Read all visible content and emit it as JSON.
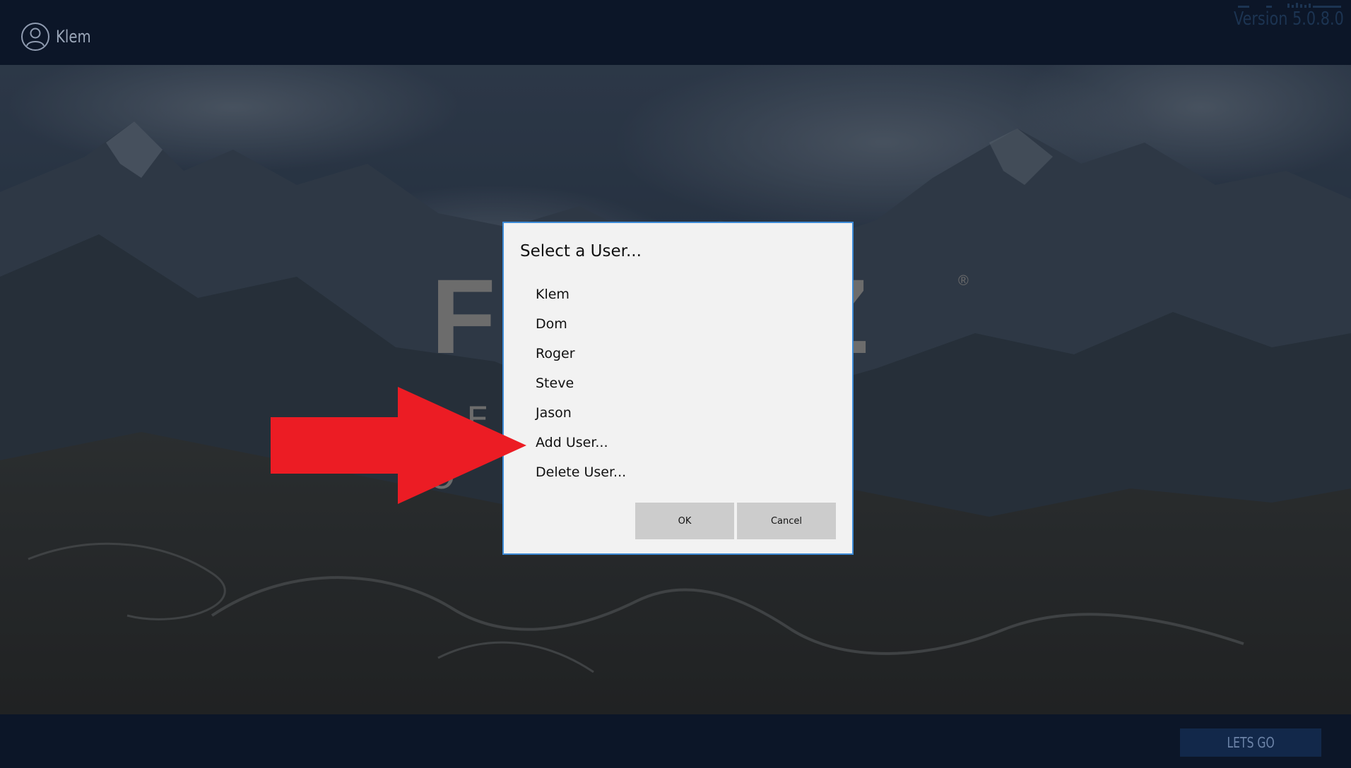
{
  "header": {
    "user_name": "Klem",
    "version": "Version 5.0.8.0"
  },
  "logo": {
    "wordmark": "F        AZ",
    "registered": "®",
    "line1": "E              A   L",
    "line2": "O             T   Y"
  },
  "dialog": {
    "title": "Select a User...",
    "items": [
      {
        "label": "Klem"
      },
      {
        "label": "Dom"
      },
      {
        "label": "Roger"
      },
      {
        "label": "Steve"
      },
      {
        "label": "Jason"
      },
      {
        "label": "Add User..."
      },
      {
        "label": "Delete User..."
      }
    ],
    "ok_label": "OK",
    "cancel_label": "Cancel"
  },
  "footer": {
    "go_label": "LETS GO"
  },
  "icons": {
    "avatar": "user-avatar-icon",
    "arrow": "red-arrow-icon"
  },
  "colors": {
    "bar_background": "#0c1628",
    "dialog_border": "#3c8ad6",
    "arrow": "#ec1c24",
    "go_button": "#12284a"
  }
}
